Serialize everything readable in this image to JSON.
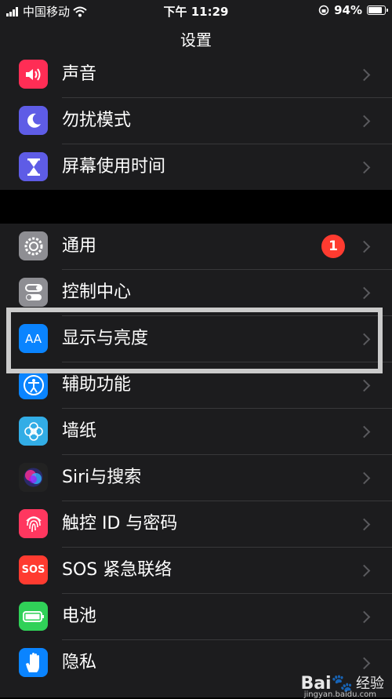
{
  "status_bar": {
    "carrier": "中国移动",
    "time": "下午 11:29",
    "battery": "94%"
  },
  "nav": {
    "title": "设置"
  },
  "group1": [
    {
      "label": "声音",
      "icon": "speaker-icon",
      "color": "#ff2d55"
    },
    {
      "label": "勿扰模式",
      "icon": "moon-icon",
      "color": "#5e5ce6"
    },
    {
      "label": "屏幕使用时间",
      "icon": "hourglass-icon",
      "color": "#5e5ce6"
    }
  ],
  "group2": [
    {
      "label": "通用",
      "icon": "gear-icon",
      "color": "#8e8e93",
      "badge": "1"
    },
    {
      "label": "控制中心",
      "icon": "toggles-icon",
      "color": "#8e8e93"
    },
    {
      "label": "显示与亮度",
      "icon": "text-size-icon",
      "color": "#0a84ff",
      "icon_text": "AA"
    },
    {
      "label": "辅助功能",
      "icon": "accessibility-icon",
      "color": "#0a84ff"
    },
    {
      "label": "墙纸",
      "icon": "flower-icon",
      "color": "#32ade6"
    },
    {
      "label": "Siri与搜索",
      "icon": "siri-icon",
      "color": "#1c1c1e"
    },
    {
      "label": "触控 ID 与密码",
      "icon": "fingerprint-icon",
      "color": "#ff375f"
    },
    {
      "label": "SOS 紧急联络",
      "icon": "sos-icon",
      "color": "#ff3b30",
      "icon_text": "SOS"
    },
    {
      "label": "电池",
      "icon": "battery-icon",
      "color": "#30d158"
    },
    {
      "label": "隐私",
      "icon": "hand-icon",
      "color": "#0a84ff"
    }
  ],
  "watermark": {
    "logo": "Bai🐾",
    "text": "经验",
    "url": "jingyan.baidu.com"
  }
}
